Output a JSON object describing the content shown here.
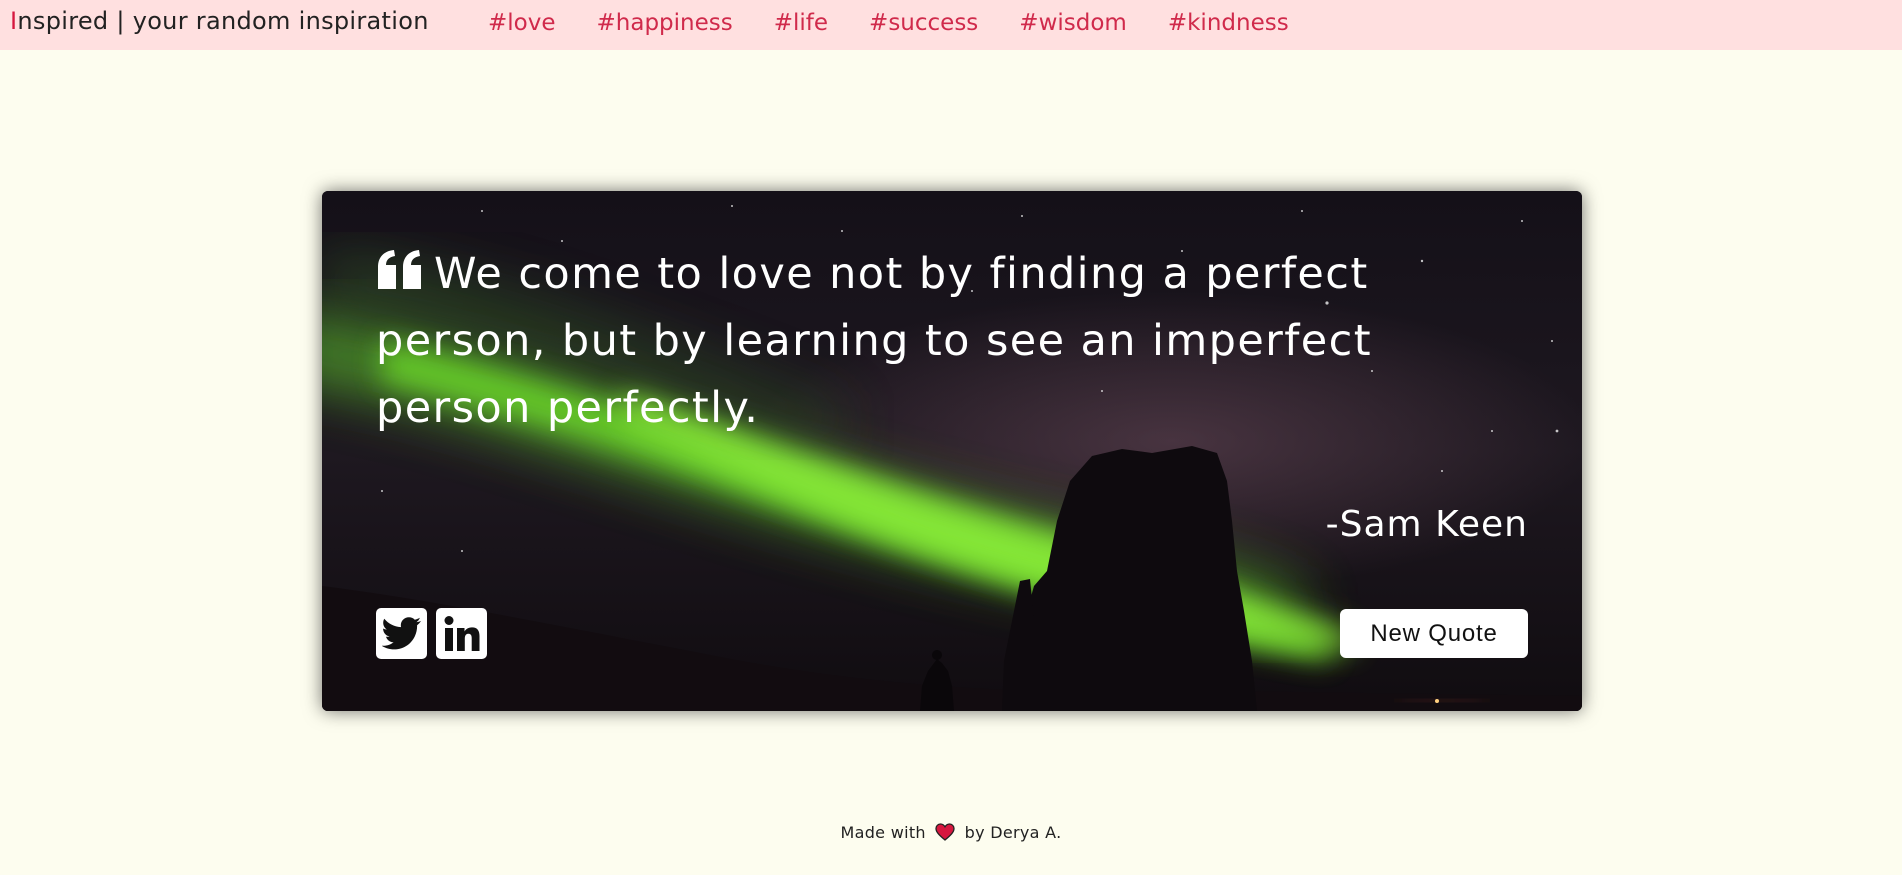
{
  "header": {
    "brand_first_letter": "I",
    "brand_rest": "nspired | your random inspiration",
    "tags": [
      "#love",
      "#happiness",
      "#life",
      "#success",
      "#wisdom",
      "#kindness"
    ]
  },
  "card": {
    "quote_text": "We come to love not by finding a perfect person, but by learning to see an imperfect person perfectly.",
    "author": "-Sam Keen",
    "social": {
      "twitter_icon": "twitter-icon",
      "linkedin_icon": "linkedin-icon"
    },
    "new_quote_label": "New Quote"
  },
  "footer": {
    "prefix": "Made with",
    "heart_icon": "heart-icon",
    "suffix": "by Derya A."
  },
  "colors": {
    "header_bg": "#ffe0e0",
    "page_bg": "#fdfdef",
    "tag_color": "#d02a4b",
    "brand_accent": "#d6173f",
    "heart": "#d6173f"
  }
}
